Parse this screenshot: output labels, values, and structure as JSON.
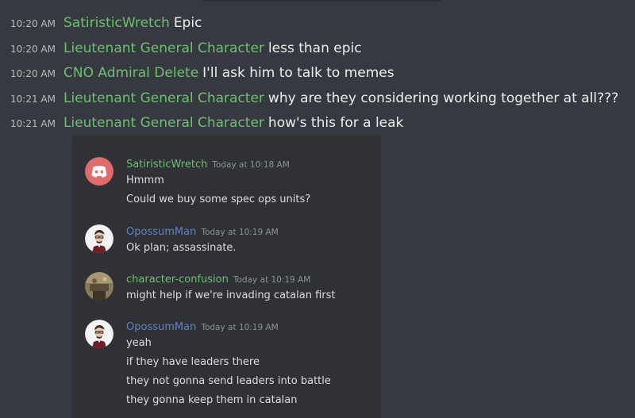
{
  "messages": [
    {
      "time": "10:20 AM",
      "author": "SatiristicWretch",
      "text": "Epic"
    },
    {
      "time": "10:20 AM",
      "author": "Lieutenant General Character",
      "text": "less than epic"
    },
    {
      "time": "10:20 AM",
      "author": "CNO Admiral Delete",
      "text": "I'll ask him to talk to memes"
    },
    {
      "time": "10:21 AM",
      "author": "Lieutenant General Character",
      "text": "why are they considering working together at all???"
    },
    {
      "time": "10:21 AM",
      "author": "Lieutenant General Character",
      "text": "how's this for a leak"
    }
  ],
  "embed": {
    "posts": [
      {
        "author": "SatiristicWretch",
        "time": "Today at 10:18 AM",
        "avatar": "discord-logo-icon",
        "lines": [
          "Hmmm",
          "Could we buy some spec ops units?"
        ]
      },
      {
        "author": "OpossumMan",
        "time": "Today at 10:19 AM",
        "avatar": "cartoon-man-avatar-icon",
        "lines": [
          "Ok plan; assassinate."
        ]
      },
      {
        "author": "character-confusion",
        "time": "Today at 10:19 AM",
        "avatar": "photo-avatar-icon",
        "lines": [
          "might help if we're invading catalan first"
        ]
      },
      {
        "author": "OpossumMan",
        "time": "Today at 10:19 AM",
        "avatar": "cartoon-man-avatar-icon",
        "lines": [
          "yeah",
          "if they have leaders there",
          "they not gonna send leaders into battle",
          "they gonna keep them in catalan"
        ]
      }
    ]
  },
  "colors": {
    "background": "#36393f",
    "embed_background": "#2f3136",
    "username_green": "#6fbf73",
    "username_blue": "#5b84c4",
    "discord_red": "#e06c6c"
  }
}
